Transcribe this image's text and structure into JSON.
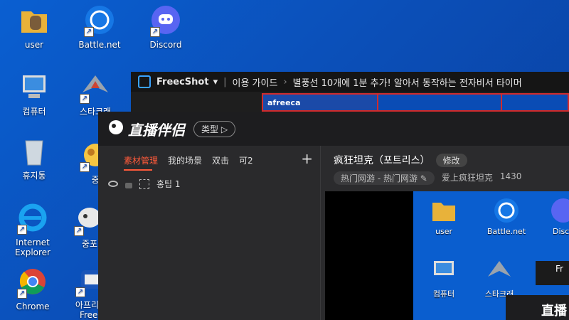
{
  "desktop": {
    "icons": [
      {
        "label": "user"
      },
      {
        "label": "Battle.net"
      },
      {
        "label": "Discord"
      },
      {
        "label": "컴퓨터"
      },
      {
        "label": "스타크래"
      },
      {
        "label": "휴지통"
      },
      {
        "label": "중"
      },
      {
        "label": "Internet Explorer"
      },
      {
        "label": "중포"
      },
      {
        "label": "Chrome"
      },
      {
        "label": "아프리카 Freec"
      }
    ]
  },
  "freecshot": {
    "title": "FreecShot",
    "menu_arrow": "▾",
    "guide": "이용 가이드",
    "sep": "›",
    "notice": "별풍선 10개에 1분 추가! 알아서 동작하는 전자비서 타이머"
  },
  "app": {
    "brand": "直播伴侣",
    "type_button": "类型",
    "tabs": [
      "素材管理",
      "我的场景",
      "双击",
      "可2"
    ],
    "plus": "+",
    "scene_name": "홍팁 1",
    "room_title": "疯狂坦克（포트리스）",
    "edit_button": "修改",
    "category": "热门网游 - 热门网游",
    "streamer": "爱上疯狂坦克",
    "count": "1430"
  },
  "preview": {
    "icons": [
      {
        "label": "user"
      },
      {
        "label": "Battle.net"
      },
      {
        "label": "Disco"
      },
      {
        "label": "컴퓨터"
      },
      {
        "label": "스타크래"
      }
    ],
    "inner_title": "Fr",
    "inner_brand": "直播"
  }
}
